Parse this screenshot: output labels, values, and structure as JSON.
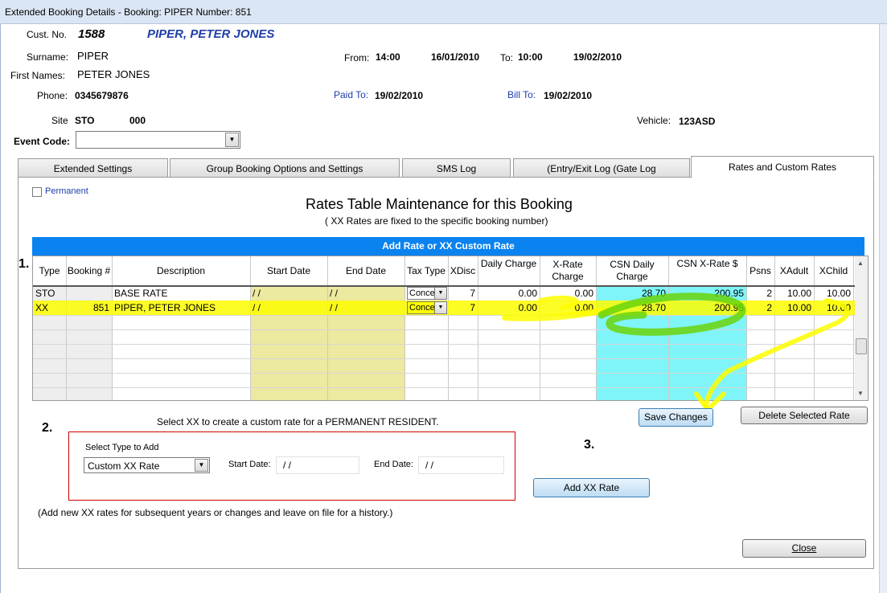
{
  "window": {
    "title": "Extended Booking Details - Booking: PIPER Number: 851"
  },
  "header": {
    "cust_no_label": "Cust. No.",
    "cust_no": "1588",
    "cust_name": "PIPER, PETER JONES",
    "surname_label": "Surname:",
    "surname": "PIPER",
    "first_names_label": "First Names:",
    "first_names": "PETER JONES",
    "phone_label": "Phone:",
    "phone": "0345679876",
    "site_label": "Site",
    "site": "STO",
    "site_num": "000",
    "from_label": "From:",
    "from_time": "14:00",
    "from_date": "16/01/2010",
    "to_label": "To:",
    "to_time": "10:00",
    "to_date": "19/02/2010",
    "paid_to_label": "Paid To:",
    "paid_to": "19/02/2010",
    "bill_to_label": "Bill To:",
    "bill_to": "19/02/2010",
    "vehicle_label": "Vehicle:",
    "vehicle": "123ASD",
    "event_code_label": "Event Code:",
    "event_code": ""
  },
  "tabs": [
    {
      "label": "Extended Settings"
    },
    {
      "label": "Group Booking Options and Settings"
    },
    {
      "label": "SMS Log"
    },
    {
      "label": "(Entry/Exit Log (Gate Log"
    },
    {
      "label": "Rates and Custom Rates"
    }
  ],
  "rates": {
    "permanent_label": "Permanent",
    "title": "Rates Table Maintenance for this Booking",
    "subtitle": "( XX Rates are fixed to the specific booking number)",
    "grid_title": "Add Rate or  XX Custom Rate",
    "columns": {
      "type": "Type",
      "booking": "Booking #",
      "description": "Description",
      "start_date": "Start Date",
      "end_date": "End Date",
      "tax_type": "Tax Type",
      "xdisc": "XDisc",
      "daily_charge": "Daily Charge",
      "xrate_charge": "X-Rate Charge",
      "csn_daily": "CSN  Daily Charge",
      "csn_xrate": "CSN X-Rate $",
      "psns": "Psns",
      "xadult": "XAdult",
      "xchild": "XChild"
    },
    "rows": [
      {
        "type": "STO",
        "booking": "",
        "description": "BASE RATE",
        "start_date": "/ /",
        "end_date": "/ /",
        "tax_type": "Conce",
        "xdisc": "7",
        "daily_charge": "0.00",
        "xrate_charge": "0.00",
        "csn_daily": "28.70",
        "csn_xrate": "200.95",
        "psns": "2",
        "xadult": "10.00",
        "xchild": "10.00"
      },
      {
        "type": "XX",
        "booking": "851",
        "description": "PIPER, PETER JONES",
        "start_date": "/ /",
        "end_date": "/ /",
        "tax_type": "Conce",
        "xdisc": "7",
        "daily_charge": "0.00",
        "xrate_charge": "0.00",
        "csn_daily": "28.70",
        "csn_xrate": "200.95",
        "psns": "2",
        "xadult": "10.00",
        "xchild": "10.00"
      }
    ],
    "save_label": "Save Changes",
    "delete_label": "Delete Selected Rate",
    "hint": "Select XX to create a custom rate for a PERMANENT RESIDENT.",
    "select_type_label": "Select Type to Add",
    "select_type_value": "Custom XX Rate",
    "start_date_label": "Start Date:",
    "start_date_value": "/ /",
    "end_date_label": "End Date:",
    "end_date_value": "/ /",
    "add_label": "Add  XX Rate",
    "footnote": "(Add new XX rates for subsequent years or changes and leave on file for a history.)",
    "close_label": "Close"
  },
  "annotations": {
    "m1": "1.",
    "m2": "2.",
    "m3": "3."
  },
  "colors": {
    "highlight": "#fdfd00",
    "grid_header": "#0a83f0",
    "date_col": "#ece9a0",
    "csn_col": "#7ff5f9",
    "green_marker": "#6ad40a"
  }
}
